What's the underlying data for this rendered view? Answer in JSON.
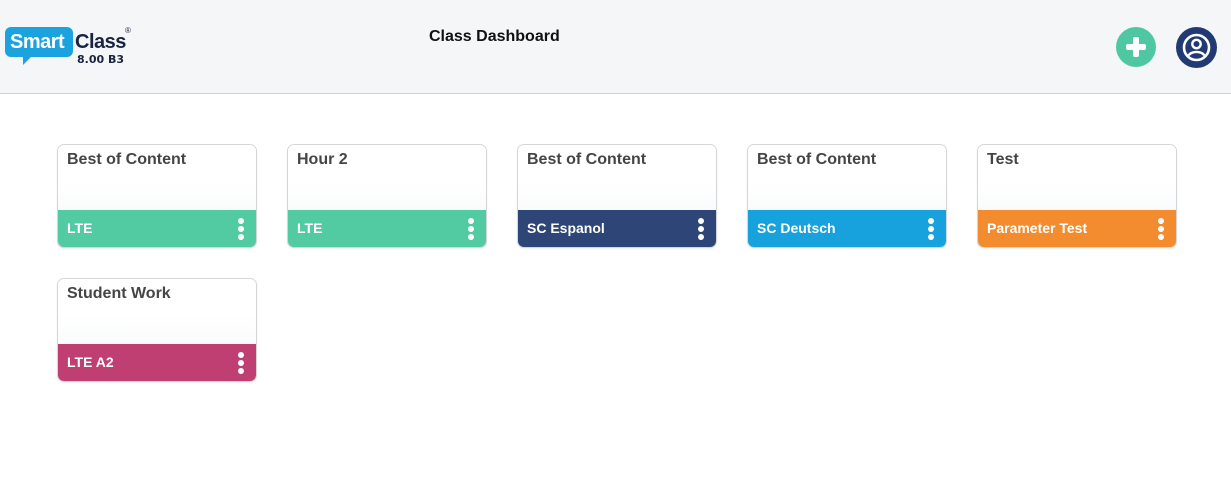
{
  "header": {
    "logo_smart": "Smart",
    "logo_class": "Class",
    "logo_reg": "®",
    "logo_version": "8.00 B3",
    "title": "Class Dashboard",
    "add_icon": "plus-circle-icon",
    "user_icon": "user-circle-icon",
    "add_color": "#4fc7a1",
    "user_color": "#223a73"
  },
  "classes": [
    {
      "name": "Best of Content",
      "subtitle": "LTE",
      "color": "#52cba3"
    },
    {
      "name": "Hour 2",
      "subtitle": "LTE",
      "color": "#52cba3"
    },
    {
      "name": "Best of Content",
      "subtitle": "SC Espanol",
      "color": "#2e4677"
    },
    {
      "name": "Best of Content",
      "subtitle": "SC Deutsch",
      "color": "#17a2de"
    },
    {
      "name": "Test",
      "subtitle": "Parameter Test",
      "color": "#f38c2e"
    },
    {
      "name": "Student Work",
      "subtitle": "LTE A2",
      "color": "#bf3f73"
    }
  ]
}
